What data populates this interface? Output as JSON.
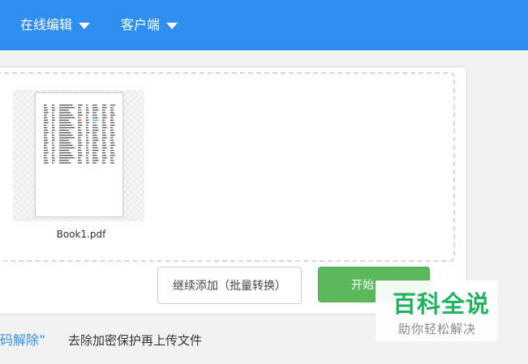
{
  "nav": {
    "items": [
      {
        "label": "在线编辑"
      },
      {
        "label": "客户端"
      }
    ]
  },
  "upload": {
    "file": {
      "name": "Book1.pdf"
    },
    "add_button": "继续添加（批量转换）",
    "start_button": "开始"
  },
  "hint": {
    "link": "码解除”",
    "text": "去除加密保护再上传文件"
  },
  "watermark": {
    "title": "百科全说",
    "subtitle": "助你轻松解决"
  },
  "colors": {
    "topbar": "#2e8ff0",
    "start_button": "#5cb85c",
    "watermark": "#1fb35f"
  }
}
